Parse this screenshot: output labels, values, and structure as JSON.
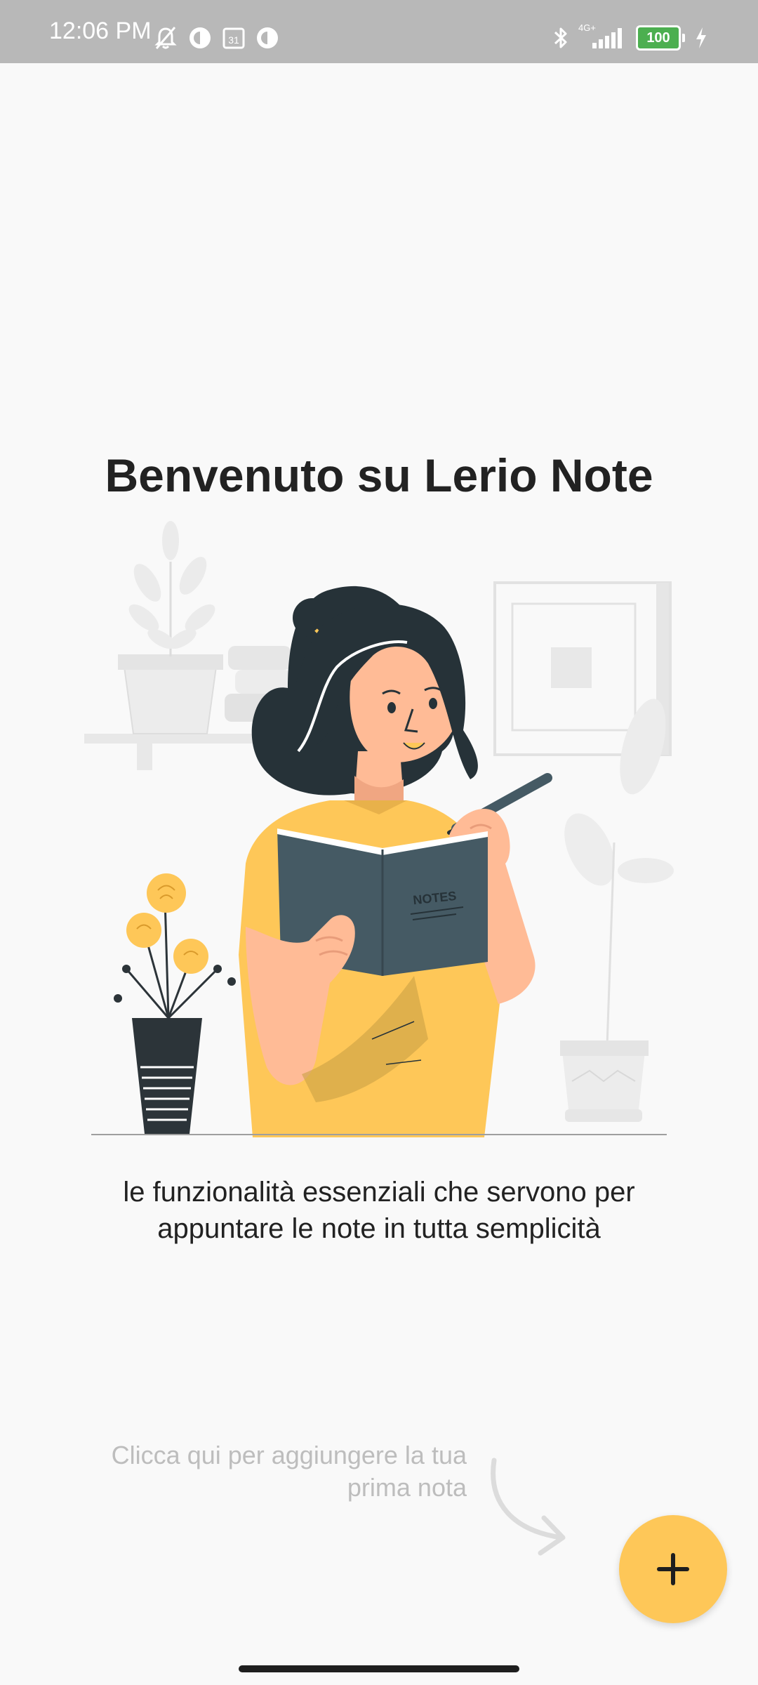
{
  "status_bar": {
    "time": "12:06 PM",
    "battery": "100",
    "network": "4G+",
    "icons_left": [
      "bell-off-icon",
      "app-icon",
      "calendar-icon",
      "app-icon"
    ],
    "icons_right": [
      "bluetooth-icon",
      "signal-icon",
      "battery-icon",
      "charging-icon"
    ]
  },
  "welcome": {
    "title": "Benvenuto su Lerio Note",
    "subtitle": "le funzionalità essenziali che servono per\nappuntare le note in tutta semplicità"
  },
  "illustration": {
    "notebook_label": "NOTES"
  },
  "hint": {
    "text": "Clicca qui per aggiungere la tua\nprima nota"
  },
  "fab": {
    "icon": "plus-icon",
    "label": "+"
  },
  "colors": {
    "accent": "#fec758",
    "status_bar": "#b8b8b8",
    "background": "#f9f9f9",
    "text": "#222222",
    "hint_text": "#bdbdbd",
    "battery": "#4caf50"
  }
}
